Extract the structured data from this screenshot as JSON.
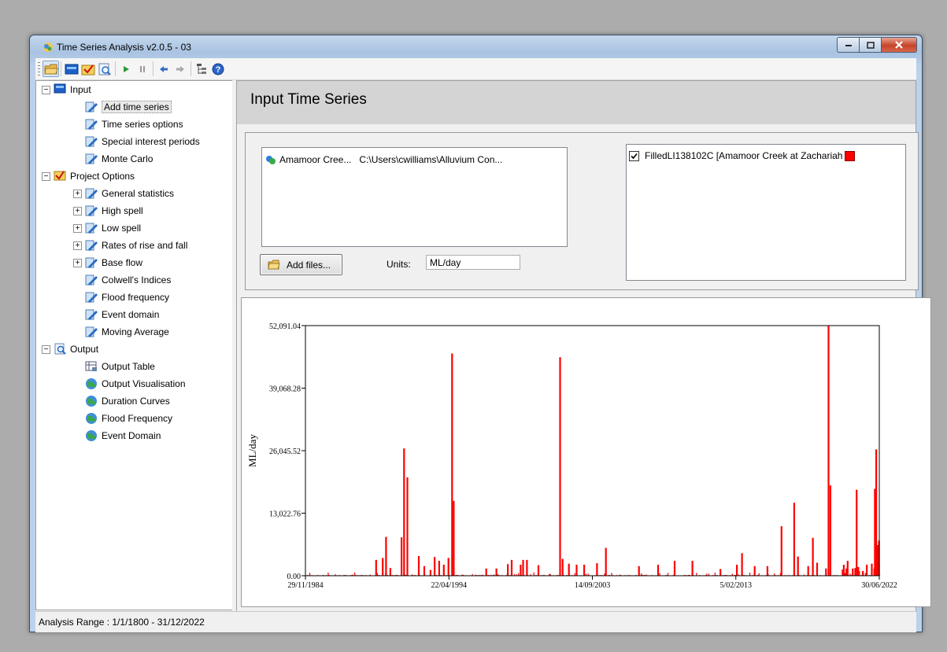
{
  "window": {
    "title": "Time Series Analysis v2.0.5 - 03"
  },
  "toolbar": {
    "buttons": [
      "open-folder-icon",
      "input-icon",
      "project-options-icon",
      "output-icon",
      "play-icon",
      "pause-icon",
      "back-icon",
      "forward-icon",
      "tree-icon",
      "help-icon"
    ]
  },
  "tree": {
    "input": {
      "label": "Input",
      "children": [
        "Add time series",
        "Time series options",
        "Special interest periods",
        "Monte Carlo"
      ]
    },
    "project_options": {
      "label": "Project Options",
      "children": [
        "General statistics",
        "High spell",
        "Low spell",
        "Rates of rise and fall",
        "Base flow",
        "Colwell's Indices",
        "Flood frequency",
        "Event domain",
        "Moving Average"
      ]
    },
    "output": {
      "label": "Output",
      "children": [
        "Output Table",
        "Output Visualisation",
        "Duration Curves",
        "Flood Frequency",
        "Event Domain"
      ]
    }
  },
  "main": {
    "title": "Input Time Series",
    "file_entry": {
      "name": "Amamoor Cree...",
      "path": "C:\\Users\\cwilliams\\Alluvium Con..."
    },
    "add_files_label": "Add files...",
    "units_label": "Units:",
    "units_value": "ML/day",
    "series_entry": {
      "label": "FilledLI138102C [Amamoor Creek at Zachariah",
      "checked": true,
      "color": "#ff0000"
    }
  },
  "chart_data": {
    "type": "bar",
    "ylabel": "ML/day",
    "ylim": [
      0,
      52091.04
    ],
    "yticks": [
      "0.00",
      "13,022.76",
      "26,045.52",
      "39,068.28",
      "52,091.04"
    ],
    "xticks": [
      "29/11/1984",
      "22/04/1994",
      "14/09/2003",
      "5/02/2013",
      "30/06/2022"
    ],
    "xlim": [
      "1984-11-29",
      "2022-06-30"
    ],
    "series_color": "#ff0000",
    "peaks": [
      {
        "date": "1989-07-15",
        "value": 3300
      },
      {
        "date": "1989-12-20",
        "value": 3700
      },
      {
        "date": "1990-03-10",
        "value": 8100
      },
      {
        "date": "1990-06-20",
        "value": 1600
      },
      {
        "date": "1991-03-15",
        "value": 8000
      },
      {
        "date": "1991-05-15",
        "value": 26500
      },
      {
        "date": "1991-08-01",
        "value": 20500
      },
      {
        "date": "1992-05-01",
        "value": 4100
      },
      {
        "date": "1992-09-10",
        "value": 2000
      },
      {
        "date": "1993-02-05",
        "value": 1200
      },
      {
        "date": "1993-05-15",
        "value": 3900
      },
      {
        "date": "1993-09-01",
        "value": 3100
      },
      {
        "date": "1993-12-20",
        "value": 2300
      },
      {
        "date": "1994-04-10",
        "value": 3700
      },
      {
        "date": "1994-07-06",
        "value": 46300
      },
      {
        "date": "1994-08-15",
        "value": 15600
      },
      {
        "date": "1996-10-01",
        "value": 1500
      },
      {
        "date": "1997-06-01",
        "value": 1500
      },
      {
        "date": "1998-03-01",
        "value": 2400
      },
      {
        "date": "1998-06-01",
        "value": 3300
      },
      {
        "date": "1999-01-01",
        "value": 2300
      },
      {
        "date": "1999-03-01",
        "value": 3300
      },
      {
        "date": "1999-06-01",
        "value": 3300
      },
      {
        "date": "2000-03-01",
        "value": 2200
      },
      {
        "date": "2001-08-01",
        "value": 45500
      },
      {
        "date": "2001-10-01",
        "value": 3500
      },
      {
        "date": "2002-03-01",
        "value": 2500
      },
      {
        "date": "2002-09-01",
        "value": 2300
      },
      {
        "date": "2003-03-01",
        "value": 2300
      },
      {
        "date": "2004-01-01",
        "value": 2600
      },
      {
        "date": "2004-08-01",
        "value": 5800
      },
      {
        "date": "2006-10-01",
        "value": 2000
      },
      {
        "date": "2008-01-01",
        "value": 2300
      },
      {
        "date": "2009-02-01",
        "value": 3100
      },
      {
        "date": "2010-04-01",
        "value": 3100
      },
      {
        "date": "2012-02-01",
        "value": 1400
      },
      {
        "date": "2013-03-01",
        "value": 2300
      },
      {
        "date": "2013-07-01",
        "value": 4700
      },
      {
        "date": "2014-05-01",
        "value": 2000
      },
      {
        "date": "2015-03-01",
        "value": 2000
      },
      {
        "date": "2016-02-01",
        "value": 10300
      },
      {
        "date": "2016-12-01",
        "value": 15200
      },
      {
        "date": "2017-03-01",
        "value": 4000
      },
      {
        "date": "2017-11-01",
        "value": 2000
      },
      {
        "date": "2018-02-20",
        "value": 7900
      },
      {
        "date": "2018-06-01",
        "value": 2700
      },
      {
        "date": "2019-01-01",
        "value": 1500
      },
      {
        "date": "2019-03-01",
        "value": 52091
      },
      {
        "date": "2019-04-15",
        "value": 18800
      },
      {
        "date": "2020-06-01",
        "value": 3100
      },
      {
        "date": "2021-01-01",
        "value": 17900
      },
      {
        "date": "2021-02-10",
        "value": 1800
      },
      {
        "date": "2022-01-01",
        "value": 2500
      },
      {
        "date": "2022-03-01",
        "value": 1500
      },
      {
        "date": "2022-05-10",
        "value": 2000
      },
      {
        "date": "2020-02-01",
        "value": 1300
      },
      {
        "date": "2020-10-01",
        "value": 1500
      },
      {
        "date": "2020-12-01",
        "value": 1600
      },
      {
        "date": "2021-06-01",
        "value": 1000
      },
      {
        "date": "2021-09-01",
        "value": 2300
      },
      {
        "date": "2022-04-01",
        "value": 1000
      }
    ],
    "late_peaks": [
      {
        "date": "2020-03-01",
        "value": 2300
      },
      {
        "date": "2020-05-01",
        "value": 1500
      },
      {
        "date": "2021-01-15",
        "value": 1800
      },
      {
        "date": "2021-03-01",
        "value": 1000
      },
      {
        "date": "2022-03-15",
        "value": 18100
      },
      {
        "date": "2022-04-15",
        "value": 26300
      },
      {
        "date": "2022-05-20",
        "value": 6400
      },
      {
        "date": "2022-06-20",
        "value": 7300
      }
    ]
  },
  "status": {
    "text": "Analysis Range : 1/1/1800 - 31/12/2022"
  }
}
